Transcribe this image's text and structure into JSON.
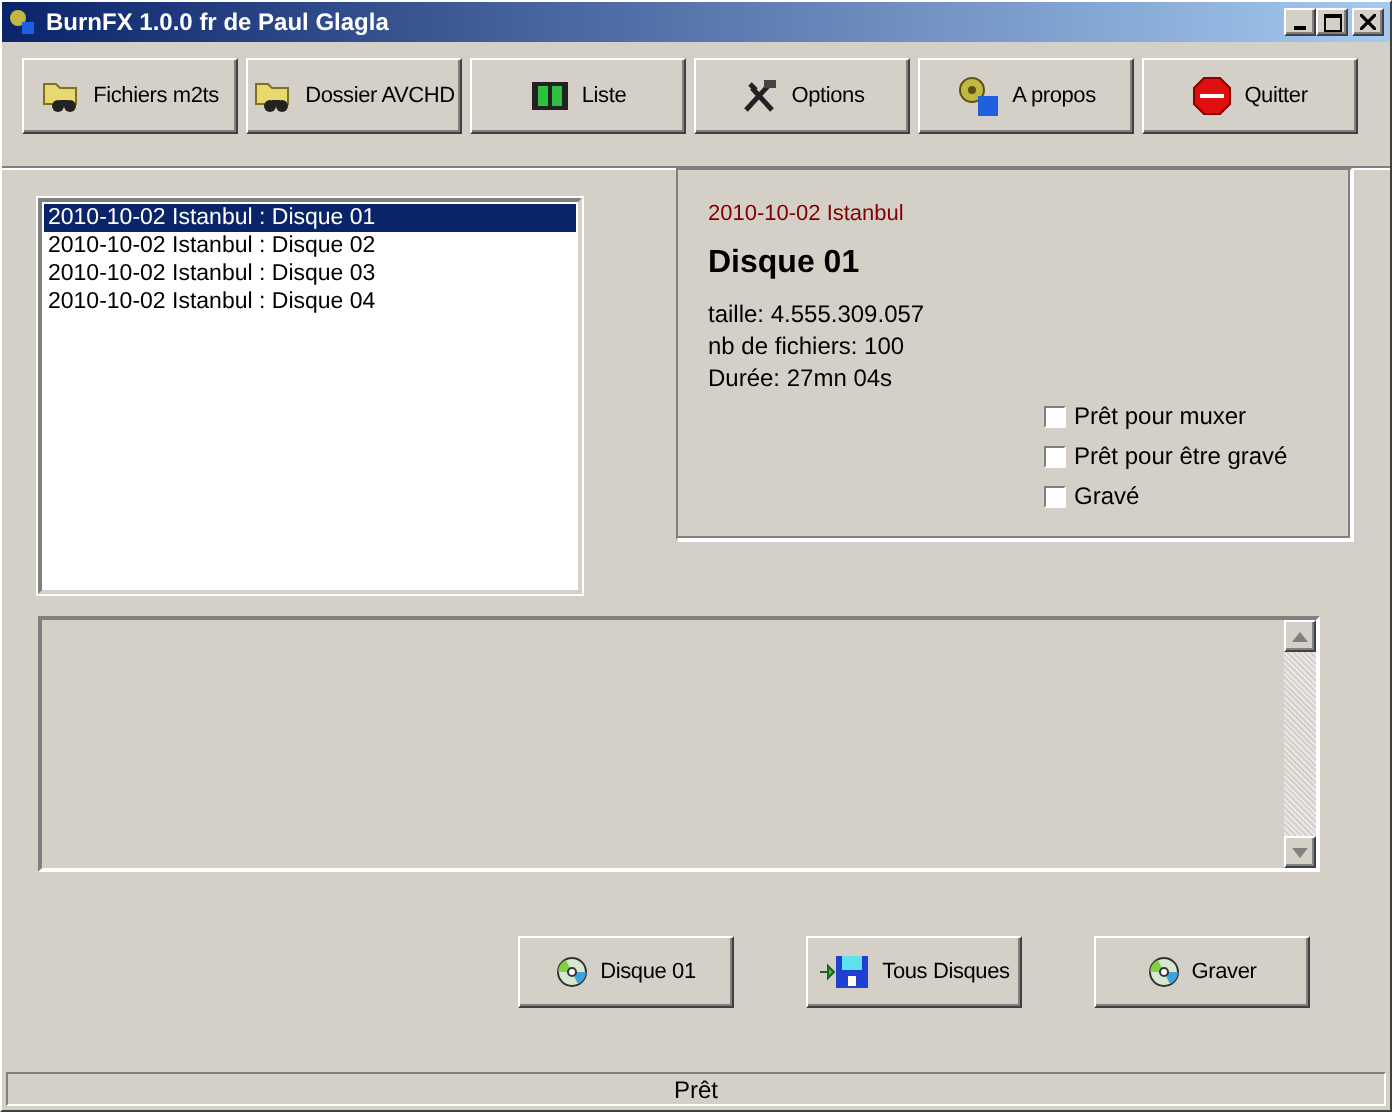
{
  "window": {
    "title": "BurnFX 1.0.0 fr de Paul Glagla"
  },
  "toolbar": [
    {
      "label": "Fichiers m2ts",
      "kind": "folder"
    },
    {
      "label": "Dossier AVCHD",
      "kind": "folder"
    },
    {
      "label": "Liste",
      "kind": "film"
    },
    {
      "label": "Options",
      "kind": "tools"
    },
    {
      "label": "A propos",
      "kind": "info"
    },
    {
      "label": "Quitter",
      "kind": "stop"
    }
  ],
  "disc_list": [
    {
      "label": "2010-10-02 Istanbul : Disque 01",
      "selected": true
    },
    {
      "label": "2010-10-02 Istanbul : Disque 02",
      "selected": false
    },
    {
      "label": "2010-10-02 Istanbul : Disque 03",
      "selected": false
    },
    {
      "label": "2010-10-02 Istanbul : Disque 04",
      "selected": false
    }
  ],
  "details": {
    "project": "2010-10-02 Istanbul",
    "disc": "Disque 01",
    "lines": [
      "taille: 4.555.309.057",
      "nb de fichiers: 100",
      "Durée: 27mn 04s"
    ],
    "checkboxes": [
      {
        "label": "Prêt pour muxer",
        "checked": false
      },
      {
        "label": "Prêt pour être gravé",
        "checked": false
      },
      {
        "label": "Gravé",
        "checked": false
      }
    ]
  },
  "actions": [
    {
      "label": "Disque 01",
      "kind": "disc"
    },
    {
      "label": "Tous Disques",
      "kind": "floppy"
    },
    {
      "label": "Graver",
      "kind": "disc"
    }
  ],
  "status_bar": "Prêt"
}
